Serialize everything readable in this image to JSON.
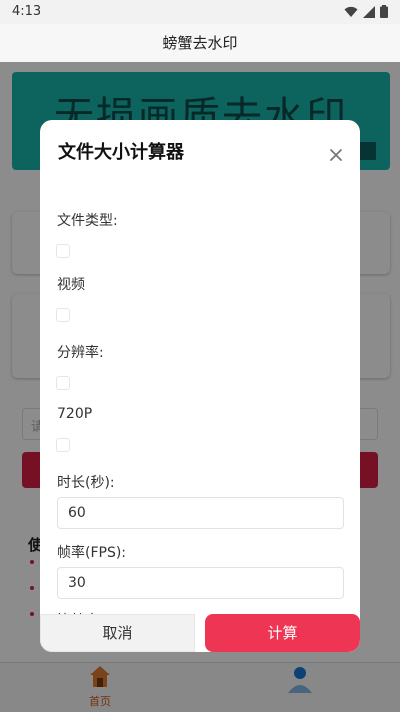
{
  "status_bar": {
    "time": "4:13"
  },
  "app_bar": {
    "title": "螃蟹去水印"
  },
  "background": {
    "banner_text": "无损画质去水印",
    "banner_color": "#19b4ac",
    "input_placeholder_char": "请",
    "heading_char": "使",
    "accent_color": "#d71f44"
  },
  "bottom_nav": {
    "home_label": "首页",
    "home_icon": "home-icon",
    "me_icon": "person-icon"
  },
  "dialog": {
    "title": "文件大小计算器",
    "close_icon": "close-icon",
    "file_type_label": "文件类型:",
    "file_type_value": "视频",
    "resolution_label": "分辨率:",
    "resolution_value": "720P",
    "duration_label": "时长(秒):",
    "duration_value": "60",
    "fps_label": "帧率(FPS):",
    "fps_value": "30",
    "next_label_partial": "比特率",
    "cancel_label": "取消",
    "calculate_label": "计算",
    "calculate_color": "#ee3553"
  }
}
